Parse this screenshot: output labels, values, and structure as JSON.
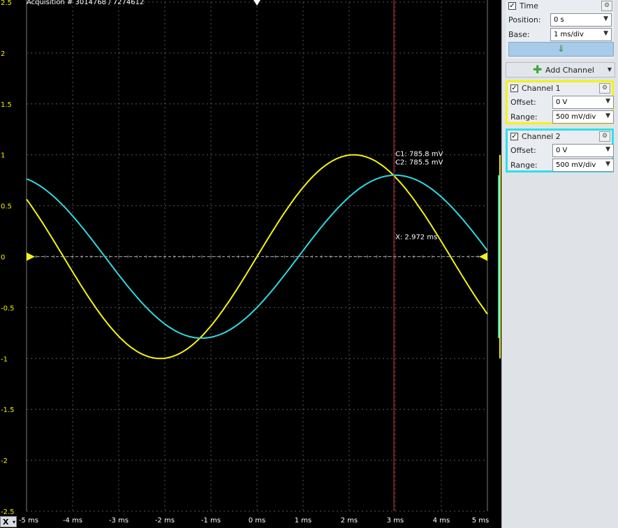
{
  "acquisition": "Acquisition # 3014768 / 7274612",
  "y_ticks": [
    "2.5",
    "2",
    "1.5",
    "1",
    "0.5",
    "0",
    "-0.5",
    "-1",
    "-1.5",
    "-2",
    "-2.5"
  ],
  "x_ticks": [
    "-5 ms",
    "-4 ms",
    "-3 ms",
    "-2 ms",
    "-1 ms",
    "0 ms",
    "1 ms",
    "2 ms",
    "3 ms",
    "4 ms",
    "5 ms"
  ],
  "x_axis_selector": "X",
  "cursor": {
    "c1_readout": "C1: 785.8 mV",
    "c2_readout": "C2: 785.5 mV",
    "x_readout": "X: 2.972 ms",
    "x_ms": 2.972
  },
  "colors": {
    "channel1": "#f3f315",
    "channel2": "#2fd9e0",
    "cursor": "#e03a3a",
    "grid": "#555555"
  },
  "chart_data": {
    "type": "line",
    "x_unit": "ms",
    "y_unit": "V",
    "xlim": [
      -5,
      5
    ],
    "ylim": [
      -2.5,
      2.5
    ],
    "grid": true,
    "series": [
      {
        "name": "Channel 1",
        "shape": "sine",
        "amplitude": 1.0,
        "period_ms": 8.4,
        "zero_cross_rising_ms": 0.0,
        "x": [
          -5,
          -4,
          -3,
          -2.1,
          -1,
          0,
          1,
          2.1,
          3,
          4,
          5
        ],
        "values": [
          0.59,
          -0.28,
          -0.82,
          -1.0,
          -0.68,
          0.0,
          0.68,
          1.0,
          0.78,
          0.31,
          -0.59
        ]
      },
      {
        "name": "Channel 2",
        "shape": "sine",
        "amplitude": 0.8,
        "period_ms": 8.4,
        "zero_cross_rising_ms": 0.9,
        "x": [
          -5,
          -4,
          -3,
          -2,
          -1.2,
          0,
          1,
          2,
          3,
          4,
          5
        ],
        "values": [
          0.77,
          0.35,
          -0.21,
          -0.65,
          -0.8,
          -0.52,
          0.06,
          0.59,
          0.79,
          0.59,
          0.06
        ]
      }
    ]
  },
  "panel": {
    "time": {
      "title": "Time",
      "position_label": "Position:",
      "position_value": "0 s",
      "base_label": "Base:",
      "base_value": "1 ms/div",
      "apply_glyph": "⇓"
    },
    "add_channel": "Add Channel",
    "channel1": {
      "title": "Channel 1",
      "offset_label": "Offset:",
      "offset_value": "0 V",
      "range_label": "Range:",
      "range_value": "500 mV/div"
    },
    "channel2": {
      "title": "Channel 2",
      "offset_label": "Offset:",
      "offset_value": "0 V",
      "range_label": "Range:",
      "range_value": "500 mV/div"
    }
  }
}
